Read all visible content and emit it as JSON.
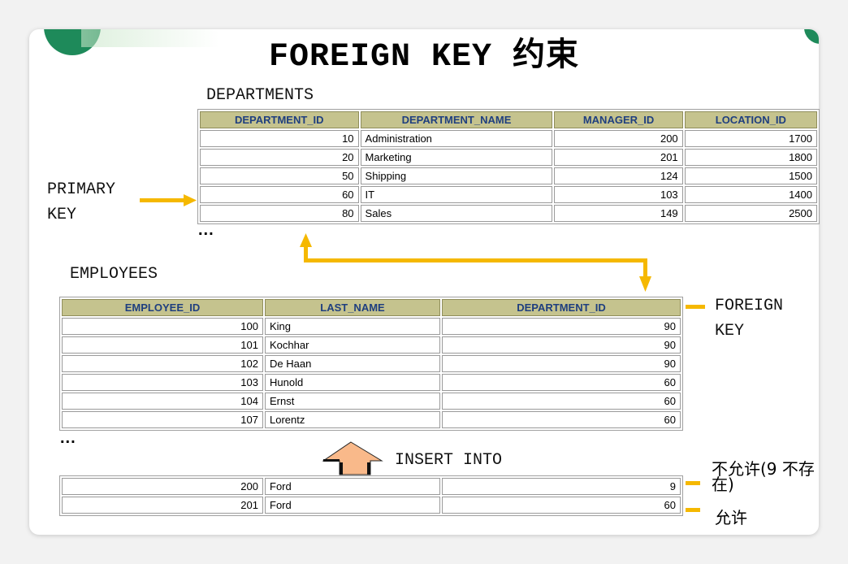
{
  "title": "FOREIGN KEY 约束",
  "departments": {
    "label": "DEPARTMENTS",
    "columns": [
      "DEPARTMENT_ID",
      "DEPARTMENT_NAME",
      "MANAGER_ID",
      "LOCATION_ID"
    ],
    "rows": [
      [
        "10",
        "Administration",
        "200",
        "1700"
      ],
      [
        "20",
        "Marketing",
        "201",
        "1800"
      ],
      [
        "50",
        "Shipping",
        "124",
        "1500"
      ],
      [
        "60",
        "IT",
        "103",
        "1400"
      ],
      [
        "80",
        "Sales",
        "149",
        "2500"
      ]
    ],
    "more": "..."
  },
  "primary_key_label": [
    "PRIMARY",
    "KEY"
  ],
  "employees": {
    "label": "EMPLOYEES",
    "columns": [
      "EMPLOYEE_ID",
      "LAST_NAME",
      "DEPARTMENT_ID"
    ],
    "rows": [
      [
        "100",
        "King",
        "90"
      ],
      [
        "101",
        "Kochhar",
        "90"
      ],
      [
        "102",
        "De Haan",
        "90"
      ],
      [
        "103",
        "Hunold",
        "60"
      ],
      [
        "104",
        "Ernst",
        "60"
      ],
      [
        "107",
        "Lorentz",
        "60"
      ]
    ],
    "more": "..."
  },
  "foreign_key_label": [
    "FOREIGN",
    "KEY"
  ],
  "insert": {
    "label": "INSERT INTO",
    "rows": [
      [
        "200",
        "Ford",
        "9"
      ],
      [
        "201",
        "Ford",
        "60"
      ]
    ],
    "notes": [
      "不允许(9 不存在)",
      "允许"
    ]
  },
  "colors": {
    "accent": "#f5b800",
    "header_bg": "#c5c38e",
    "header_text": "#1f3f7f",
    "insert_arrow": "#f9b98a"
  }
}
